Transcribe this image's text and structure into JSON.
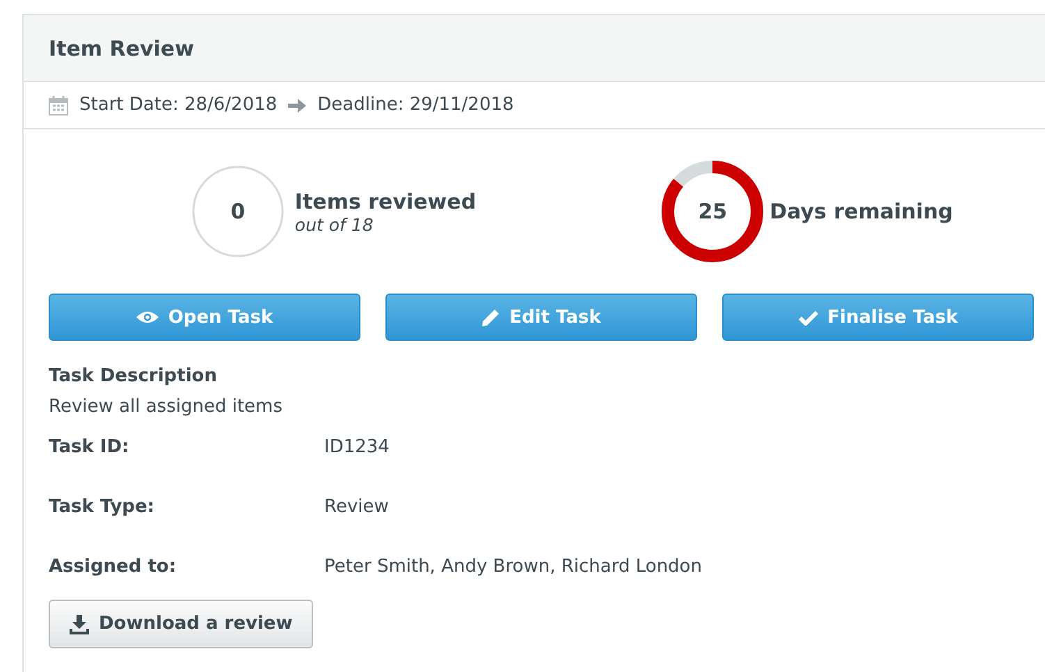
{
  "panel": {
    "title": "Item Review"
  },
  "dates": {
    "start": "Start Date: 28/6/2018",
    "deadline": "Deadline: 29/11/2018"
  },
  "gauges": [
    {
      "value": "0",
      "label": "Items reviewed",
      "sublabel": "out of 18",
      "level": 0
    },
    {
      "value": "25",
      "label": "Days remaining",
      "level": 0.86
    }
  ],
  "actions": [
    {
      "label": "Open Task",
      "kind": "view"
    },
    {
      "label": "Edit Task",
      "kind": "edit"
    },
    {
      "label": "Finalise Task",
      "kind": "finalise"
    }
  ],
  "description": {
    "heading": "Task Description",
    "text": "Review all assigned items"
  },
  "fields": [
    {
      "label": "Task ID:",
      "value": "ID1234"
    },
    {
      "label": "Task Type:",
      "value": "Review"
    },
    {
      "label": "Assigned to:",
      "value": "Peter Smith, Andy Brown, Richard London"
    }
  ],
  "download_button": "Download a review"
}
